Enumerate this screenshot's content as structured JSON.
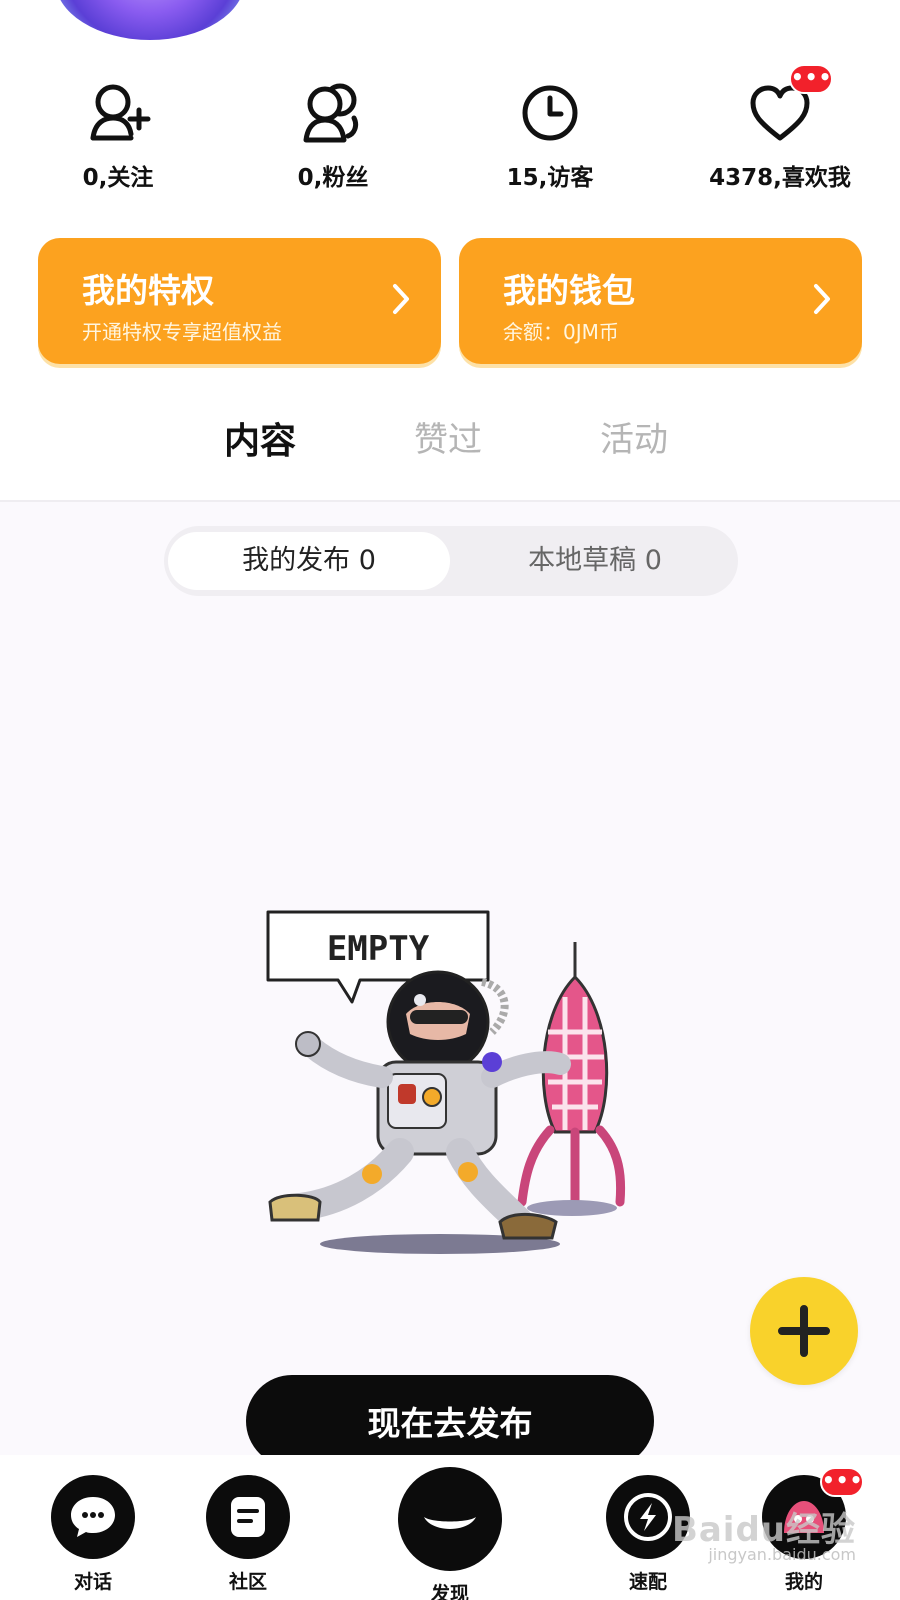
{
  "profile": {
    "stats": [
      {
        "label": "0,关注",
        "icon": "add-user-icon"
      },
      {
        "label": "0,粉丝",
        "icon": "fans-icon"
      },
      {
        "label": "15,访客",
        "icon": "clock-icon"
      },
      {
        "label": "4378,喜欢我",
        "icon": "heart-icon",
        "badge": "•••"
      }
    ]
  },
  "cards": [
    {
      "title": "我的特权",
      "subtitle": "开通特权专享超值权益"
    },
    {
      "title": "我的钱包",
      "subtitle": "余额：0JM币"
    }
  ],
  "tabs": [
    {
      "label": "内容",
      "active": true
    },
    {
      "label": "赞过",
      "active": false
    },
    {
      "label": "活动",
      "active": false
    }
  ],
  "segment": {
    "items": [
      {
        "label": "我的发布 0",
        "active": true
      },
      {
        "label": "本地草稿 0",
        "active": false
      }
    ]
  },
  "empty_state": {
    "bubble_text": "EMPTY"
  },
  "publish_button": "现在去发布",
  "bottom_nav": {
    "items": [
      {
        "label": "对话",
        "icon": "chat-icon"
      },
      {
        "label": "社区",
        "icon": "community-icon"
      },
      {
        "label": "发现",
        "icon": "discover-icon"
      },
      {
        "label": "速配",
        "icon": "lightning-icon"
      },
      {
        "label": "我的",
        "icon": "profile-icon",
        "badge": "•••"
      }
    ]
  },
  "watermark": {
    "text": "Baidu经验",
    "sub": "jingyan.baidu.com"
  },
  "colors": {
    "accent": "#fca21f",
    "fab": "#f9d22b",
    "badge": "#f2212b"
  }
}
